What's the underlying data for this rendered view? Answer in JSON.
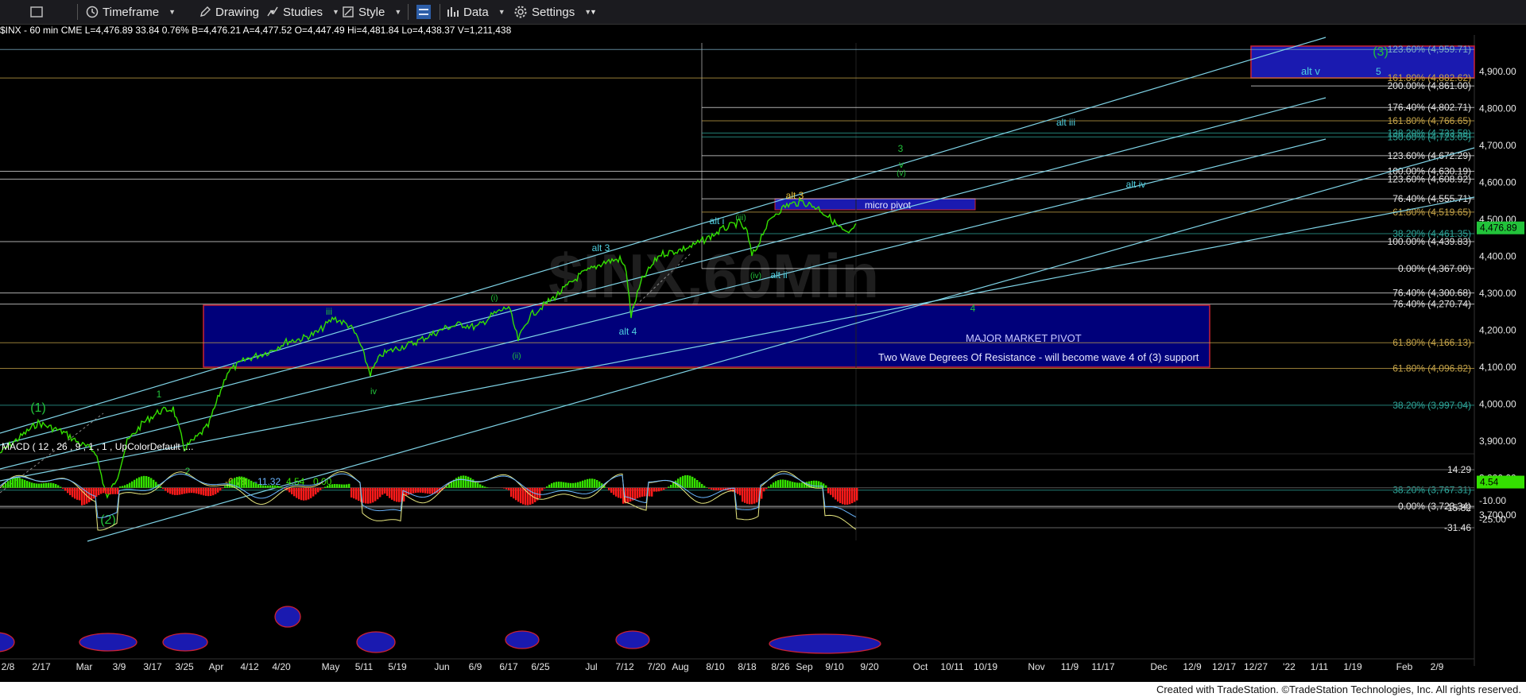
{
  "toolbar": {
    "timeframe": "Timeframe",
    "drawing": "Drawing",
    "studies": "Studies",
    "style": "Style",
    "data": "Data",
    "settings": "Settings"
  },
  "infobar": "$INX - 60 min  CME  L=4,476.89  33.84  0.76%  B=4,476.21  A=4,477.52  O=4,447.49  Hi=4,481.84  Lo=4,438.37  V=1,211,438",
  "watermark": "$INX,60Min",
  "price_axis": {
    "ticks": [
      {
        "label": "4,900.00",
        "value": 4900
      },
      {
        "label": "4,800.00",
        "value": 4800
      },
      {
        "label": "4,700.00",
        "value": 4700
      },
      {
        "label": "4,600.00",
        "value": 4600
      },
      {
        "label": "4,500.00",
        "value": 4500
      },
      {
        "label": "4,400.00",
        "value": 4400
      },
      {
        "label": "4,300.00",
        "value": 4300
      },
      {
        "label": "4,200.00",
        "value": 4200
      },
      {
        "label": "4,100.00",
        "value": 4100
      },
      {
        "label": "4,000.00",
        "value": 4000
      },
      {
        "label": "3,900.00",
        "value": 3900
      },
      {
        "label": "3,800.00",
        "value": 3800
      },
      {
        "label": "3,700.00",
        "value": 3700
      }
    ],
    "last_price": "4,476.89",
    "last_price_color": "#22c33a"
  },
  "fib_levels": [
    {
      "label": "123.60% (4,959.71)",
      "value": 4959.71,
      "color": "#7fb0c8"
    },
    {
      "label": "161.80% (4,882.62)",
      "value": 4882.62,
      "color": "#c8a64a"
    },
    {
      "label": "200.00% (4,861.00)",
      "value": 4861.0,
      "color": "#e6e6e6"
    },
    {
      "label": "176.40% (4,802.71)",
      "value": 4802.71,
      "color": "#e6e6e6"
    },
    {
      "label": "161.80% (4,766.65)",
      "value": 4766.65,
      "color": "#c8a64a"
    },
    {
      "label": "138.20% (4,733.58)",
      "value": 4733.58,
      "color": "#2fa89c"
    },
    {
      "label": "150.00% (4,723.05)",
      "value": 4723.05,
      "color": "#2fa89c"
    },
    {
      "label": "123.60% (4,672.29)",
      "value": 4672.29,
      "color": "#e6e6e6"
    },
    {
      "label": "100.00% (4,630.19)",
      "value": 4630.19,
      "color": "#e6e6e6"
    },
    {
      "label": "123.60% (4,608.92)",
      "value": 4608.92,
      "color": "#e6e6e6"
    },
    {
      "label": "76.40% (4,555.71)",
      "value": 4555.71,
      "color": "#e6e6e6"
    },
    {
      "label": "61.80% (4,519.65)",
      "value": 4519.65,
      "color": "#c8a64a"
    },
    {
      "label": "38.20% (4,461.35)",
      "value": 4461.35,
      "color": "#2fa89c"
    },
    {
      "label": "100.00% (4,439.83)",
      "value": 4439.83,
      "color": "#e6e6e6"
    },
    {
      "label": "0.00% (4,367.00)",
      "value": 4367.0,
      "color": "#e6e6e6"
    },
    {
      "label": "76.40% (4,300.68)",
      "value": 4300.68,
      "color": "#e6e6e6"
    },
    {
      "label": "76.40% (4,270.74)",
      "value": 4270.74,
      "color": "#e6e6e6"
    },
    {
      "label": "61.80% (4,166.13)",
      "value": 4166.13,
      "color": "#c8a64a"
    },
    {
      "label": "61.80% (4,096.82)",
      "value": 4096.82,
      "color": "#c8a64a"
    },
    {
      "label": "38.20% (3,997.04)",
      "value": 3997.04,
      "color": "#2fa89c"
    },
    {
      "label": "38.20% (3,767.31)",
      "value": 3767.31,
      "color": "#2fa89c"
    },
    {
      "label": "0.00% (3,723.34)",
      "value": 3723.34,
      "color": "#e6e6e6"
    }
  ],
  "boxes": {
    "major_pivot_title": "MAJOR MARKET PIVOT",
    "major_pivot_note": "Two Wave Degrees Of Resistance - will become wave 4 of (3) support",
    "micro_pivot": "micro pivot",
    "target_box_label": "alt v",
    "target_box_marker": "5"
  },
  "wave_labels": [
    {
      "text": "(1)",
      "color": "#22c33a"
    },
    {
      "text": "(2)",
      "color": "#22c33a"
    },
    {
      "text": "1",
      "color": "#22c33a"
    },
    {
      "text": "2",
      "color": "#22c33a"
    },
    {
      "text": "iii",
      "color": "#22c33a"
    },
    {
      "text": "iv",
      "color": "#22c33a"
    },
    {
      "text": "(i)",
      "color": "#22c33a"
    },
    {
      "text": "(ii)",
      "color": "#22c33a"
    },
    {
      "text": "alt 3",
      "color": "#4fd0e0"
    },
    {
      "text": "alt 4",
      "color": "#4fd0e0"
    },
    {
      "text": "alt i",
      "color": "#4fd0e0"
    },
    {
      "text": "(iii)",
      "color": "#22c33a"
    },
    {
      "text": "(iv)",
      "color": "#22c33a"
    },
    {
      "text": "alt ii",
      "color": "#4fd0e0"
    },
    {
      "text": "alt 3",
      "color": "#e8c23a"
    },
    {
      "text": "3",
      "color": "#22c33a"
    },
    {
      "text": "v",
      "color": "#22c33a"
    },
    {
      "text": "(v)",
      "color": "#22c33a"
    },
    {
      "text": "4",
      "color": "#22c33a"
    },
    {
      "text": "alt iii",
      "color": "#4fd0e0"
    },
    {
      "text": "alt iv",
      "color": "#4fd0e0"
    },
    {
      "text": "(3)",
      "color": "#22c33a"
    }
  ],
  "macd": {
    "header_name": "MACD ( 12 , 26 , 9 , 1 , 1 , UpColorDefault ,...",
    "v1": "-6.78",
    "v2": "-11.32",
    "v3": "4.54",
    "v4": "0.00",
    "axis": [
      {
        "label": "14.29",
        "value": 14.29
      },
      {
        "label": "-15.82",
        "value": -15.82
      },
      {
        "label": "-31.46",
        "value": -31.46
      }
    ],
    "axis_ticks": [
      {
        "label": "-10.00",
        "value": -10
      },
      {
        "label": "-25.00",
        "value": -25
      }
    ],
    "last": "4.54"
  },
  "date_axis": [
    "2/8",
    "2/17",
    "Mar",
    "3/9",
    "3/17",
    "3/25",
    "Apr",
    "4/12",
    "4/20",
    "May",
    "5/11",
    "5/19",
    "Jun",
    "6/9",
    "6/17",
    "6/25",
    "Jul",
    "7/12",
    "7/20",
    "Aug",
    "8/10",
    "8/18",
    "8/26",
    "Sep",
    "9/10",
    "9/20",
    "Oct",
    "10/11",
    "10/19",
    "Nov",
    "11/9",
    "11/17",
    "Dec",
    "12/9",
    "12/17",
    "12/27",
    "'22",
    "1/11",
    "1/19",
    "Feb",
    "2/9"
  ],
  "footer": "Created with TradeStation. ©TradeStation Technologies, Inc. All rights reserved."
}
